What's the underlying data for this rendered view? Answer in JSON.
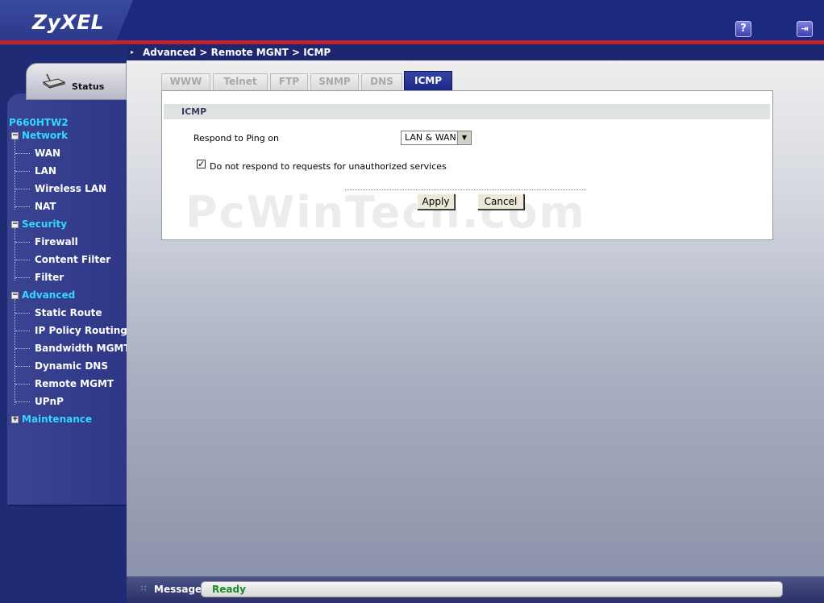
{
  "header": {
    "logo": "ZyXEL",
    "help_icon": "question-icon",
    "logout_icon": "logout-icon"
  },
  "breadcrumb": "Advanced > Remote MGNT > ICMP",
  "sidebar": {
    "status_label": "Status",
    "model": "P660HTW2",
    "sections": [
      {
        "label": "Network",
        "items": [
          "WAN",
          "LAN",
          "Wireless LAN",
          "NAT"
        ]
      },
      {
        "label": "Security",
        "items": [
          "Firewall",
          "Content Filter",
          "Filter"
        ]
      },
      {
        "label": "Advanced",
        "items": [
          "Static Route",
          "IP Policy Routing",
          "Bandwidth MGMT",
          "Dynamic DNS",
          "Remote MGMT",
          "UPnP"
        ]
      },
      {
        "label": "Maintenance",
        "items": []
      }
    ]
  },
  "tabs": [
    {
      "label": "WWW",
      "active": false
    },
    {
      "label": "Telnet",
      "active": false
    },
    {
      "label": "FTP",
      "active": false
    },
    {
      "label": "SNMP",
      "active": false
    },
    {
      "label": "DNS",
      "active": false
    },
    {
      "label": "ICMP",
      "active": true
    }
  ],
  "form": {
    "section_title": "ICMP",
    "respond_label": "Respond to Ping on",
    "respond_value": "LAN & WAN",
    "checkbox_label": "Do not respond to requests for unauthorized services",
    "checkbox_checked": true,
    "apply_label": "Apply",
    "cancel_label": "Cancel"
  },
  "watermark": "PcWinTech.com",
  "message_bar": {
    "label": "Message",
    "status": "Ready"
  },
  "colors": {
    "header": "#1c2980",
    "accent_red": "#c0232d",
    "nav_section": "#35d6ff",
    "active_tab": "#1c2880",
    "status_ready": "#1c8a2a"
  }
}
